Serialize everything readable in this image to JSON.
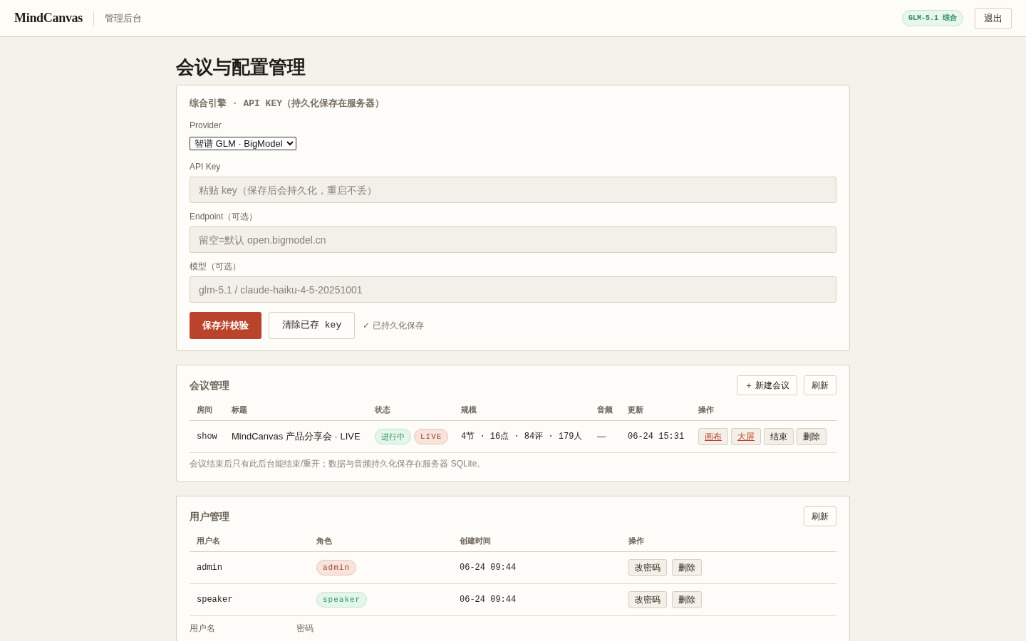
{
  "header": {
    "logo": "MindCanvas",
    "subtitle": "管理后台",
    "model_badge": "GLM-5.1 综合",
    "logout_button": "退出"
  },
  "page_title": "会议与配置管理",
  "engine_card": {
    "title": "综合引擎 · API KEY（持久化保存在服务器）",
    "fields": [
      {
        "kind": "select",
        "label": "Provider",
        "value": "智谱 GLM · BigModel"
      },
      {
        "kind": "input",
        "label": "API Key",
        "placeholder": "粘贴 key（保存后会持久化，重启不丢）"
      },
      {
        "kind": "input",
        "label": "Endpoint（可选）",
        "placeholder": "留空=默认 open.bigmodel.cn"
      },
      {
        "kind": "input",
        "label": "模型（可选）",
        "placeholder": "glm-5.1 / claude-haiku-4-5-20251001"
      }
    ],
    "buttons": [
      {
        "kind": "primary",
        "label": "保存并校验"
      },
      {
        "kind": "secondary",
        "label": "清除已存 key"
      }
    ],
    "status": "✓ 已持久化保存"
  },
  "meetings": {
    "title": "会议管理",
    "buttons": [
      "＋ 新建会议",
      "刷新"
    ],
    "columns": [
      "房间",
      "标题",
      "状态",
      "规模",
      "音频",
      "更新",
      "操作"
    ],
    "rows": [
      {
        "room": "show",
        "title": "MindCanvas 产品分享会 · LIVE",
        "badges": [
          {
            "kind": "state",
            "label": "进行中",
            "color": "#e6f5ec"
          },
          {
            "kind": "mode",
            "label": "LIVE",
            "color": "#f8e3dd"
          }
        ],
        "scale": "4节 · 16点 · 84评 · 179人",
        "audio": "—",
        "updated": "06-24 15:31",
        "actions": [
          {
            "kind": "link",
            "label": "画布"
          },
          {
            "kind": "link",
            "label": "大屏"
          },
          {
            "kind": "button",
            "label": "结束"
          },
          {
            "kind": "button",
            "label": "删除"
          }
        ]
      }
    ],
    "note": "会议结束后只有此后台能结束/重开；数据与音频持久化保存在服务器 SQLite。"
  },
  "users": {
    "title": "用户管理",
    "buttons": [
      "刷新"
    ],
    "columns": [
      "用户名",
      "角色",
      "创建时间",
      "操作"
    ],
    "rows": [
      {
        "username": "admin",
        "role": {
          "label": "admin",
          "color": "#f8e3dd"
        },
        "created": "06-24 09:44",
        "actions": [
          "改密码",
          "删除"
        ]
      },
      {
        "username": "speaker",
        "role": {
          "label": "speaker",
          "color": "#e6f5ec"
        },
        "created": "06-24 09:44",
        "actions": [
          "改密码",
          "删除"
        ]
      }
    ],
    "form_labels": [
      "用户名",
      "密码"
    ]
  }
}
